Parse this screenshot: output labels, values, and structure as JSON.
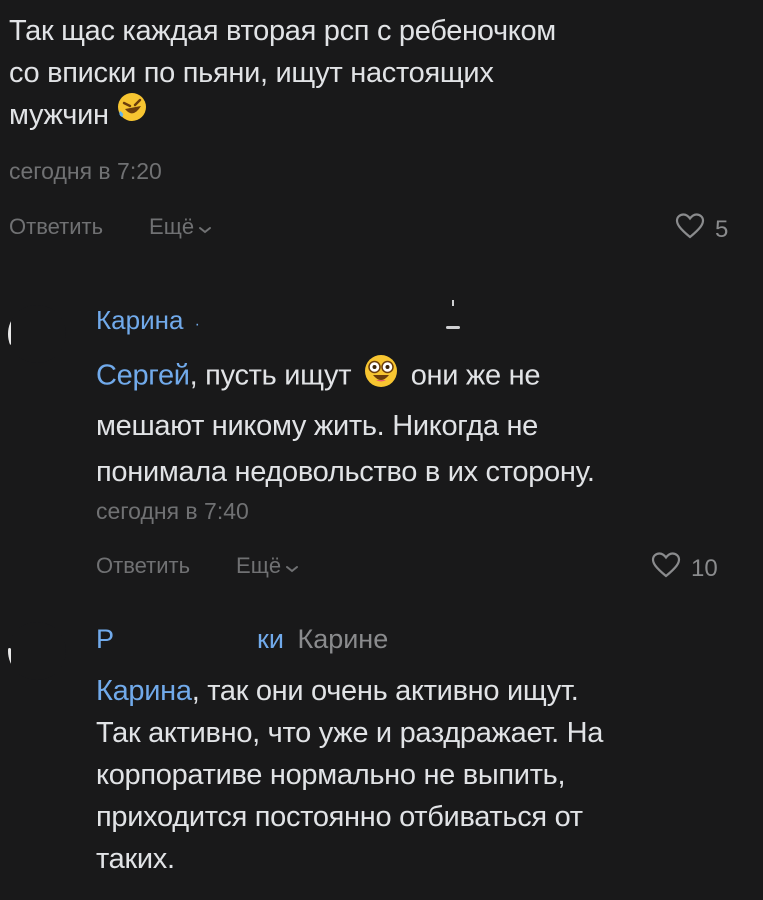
{
  "comment1": {
    "line1": "Так щас каждая вторая рсп с ребеночком",
    "line2": "со вписки по пьяни, ищут настоящих",
    "line3": "мужчин",
    "emoji": "rolling-laughing-emoji",
    "time": "сегодня в 7:20",
    "reply_label": "Ответить",
    "more_label": "Ещё",
    "likes": "5"
  },
  "comment2": {
    "author": "Карина",
    "author_suffix": "·",
    "mention": "Сергей",
    "text_a": ", пусть ищут",
    "emoji": "dizzy-face-emoji",
    "text_b": "они же не",
    "line2": "мешают никому жить. Никогда не",
    "line3": "понимала недовольство в их сторону.",
    "time": "сегодня в 7:40",
    "reply_label": "Ответить",
    "more_label": "Ещё",
    "likes": "10"
  },
  "comment3": {
    "author_start": "Р",
    "author_end": "ки",
    "reply_to": "Карине",
    "mention": "Карина",
    "text_a": ", так они очень активно ищут.",
    "line2": "Так активно, что уже и раздражает. На",
    "line3": "корпоративе нормально не выпить,",
    "line4": "приходится постоянно отбиваться от",
    "line5": "таких."
  },
  "colors": {
    "background": "#19191a",
    "text": "#e1e3e6",
    "link": "#71aaeb",
    "secondary": "#707173"
  }
}
